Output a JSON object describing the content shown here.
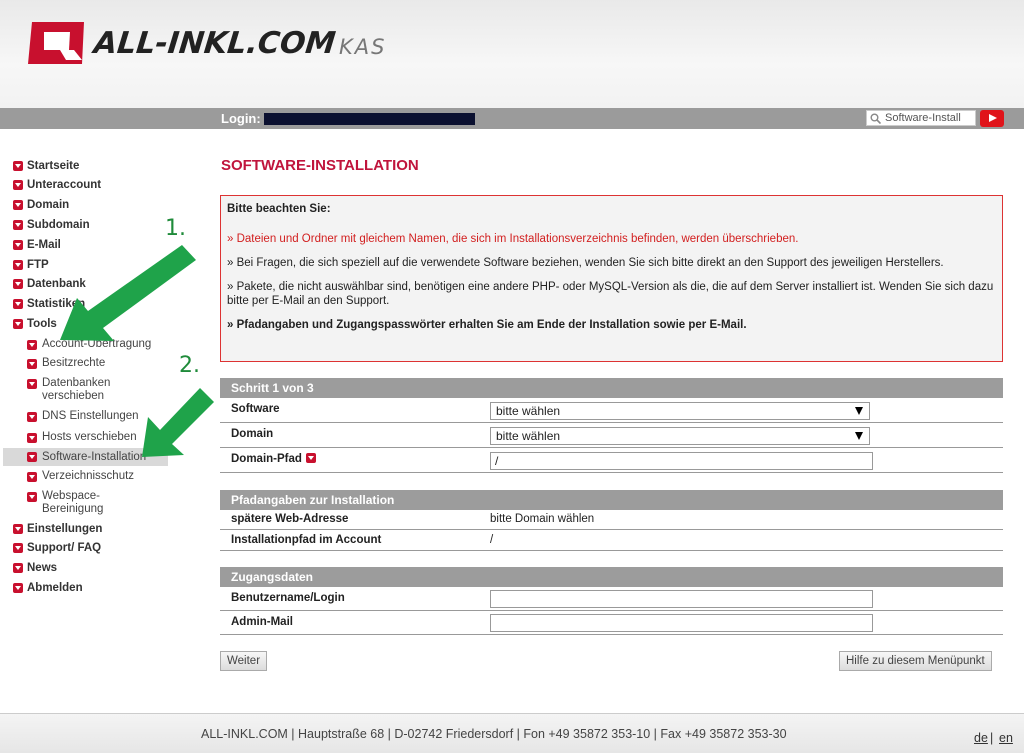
{
  "header": {
    "brand": "ALL-INKL.COM",
    "product": "KAS",
    "colors": {
      "brand_red": "#c8102e",
      "topbar": "#9b9b9b"
    }
  },
  "topbar": {
    "login_label": "Login:",
    "search_label": "Software-Install",
    "search_icon": "search-icon",
    "video_icon": "youtube-play-icon"
  },
  "sidebar": {
    "items": [
      {
        "label": "Startseite"
      },
      {
        "label": "Unteraccount"
      },
      {
        "label": "Domain"
      },
      {
        "label": "Subdomain"
      },
      {
        "label": "E-Mail"
      },
      {
        "label": "FTP"
      },
      {
        "label": "Datenbank"
      },
      {
        "label": "Statistiken"
      },
      {
        "label": "Tools"
      }
    ],
    "tools_sub": [
      {
        "label": "Account-Übertragung"
      },
      {
        "label": "Besitzrechte"
      },
      {
        "label": "Datenbanken verschieben"
      },
      {
        "label": "DNS Einstellungen"
      },
      {
        "label": "Hosts verschieben"
      },
      {
        "label": "Software-Installation",
        "active": true
      },
      {
        "label": "Verzeichnisschutz"
      },
      {
        "label": "Webspace-Bereinigung"
      }
    ],
    "items_after": [
      {
        "label": "Einstellungen"
      },
      {
        "label": "Support/ FAQ"
      },
      {
        "label": "News"
      },
      {
        "label": "Abmelden"
      }
    ]
  },
  "annotations": {
    "step1": "1.",
    "step2": "2.",
    "color": "#1fa34a"
  },
  "main": {
    "title": "SOFTWARE-INSTALLATION",
    "notice": {
      "title": "Bitte beachten Sie:",
      "line1": "» Dateien und Ordner mit gleichem Namen, die sich im Installationsverzeichnis befinden, werden überschrieben.",
      "line2": "» Bei Fragen, die sich speziell auf die verwendete Software beziehen, wenden Sie sich bitte direkt an den Support des jeweiligen Herstellers.",
      "line3": "» Pakete, die nicht auswählbar sind, benötigen eine andere PHP- oder MySQL-Version als die, die auf dem Server installiert ist. Wenden Sie sich dazu bitte per E-Mail an den Support.",
      "line4": "» Pfadangaben und Zugangspasswörter erhalten Sie am Ende der Installation sowie per E-Mail."
    },
    "step": {
      "heading": "Schritt 1 von 3",
      "software_label": "Software",
      "software_value": "bitte wählen",
      "domain_label": "Domain",
      "domain_value": "bitte wählen",
      "path_label": "Domain-Pfad",
      "path_value": "/"
    },
    "paths": {
      "heading": "Pfadangaben zur Installation",
      "web_label": "spätere Web-Adresse",
      "web_value": "bitte Domain wählen",
      "install_label": "Installationpfad im Account",
      "install_value": "/"
    },
    "access": {
      "heading": "Zugangsdaten",
      "user_label": "Benutzername/Login",
      "user_value": "",
      "mail_label": "Admin-Mail",
      "mail_value": ""
    },
    "buttons": {
      "next": "Weiter",
      "help": "Hilfe zu diesem Menüpunkt"
    }
  },
  "footer": {
    "text": "ALL-INKL.COM | Hauptstraße 68 | D-02742 Friedersdorf | Fon +49 35872 353-10 | Fax +49 35872 353-30",
    "lang_de": "de",
    "lang_sep": "|",
    "lang_en": "en"
  }
}
